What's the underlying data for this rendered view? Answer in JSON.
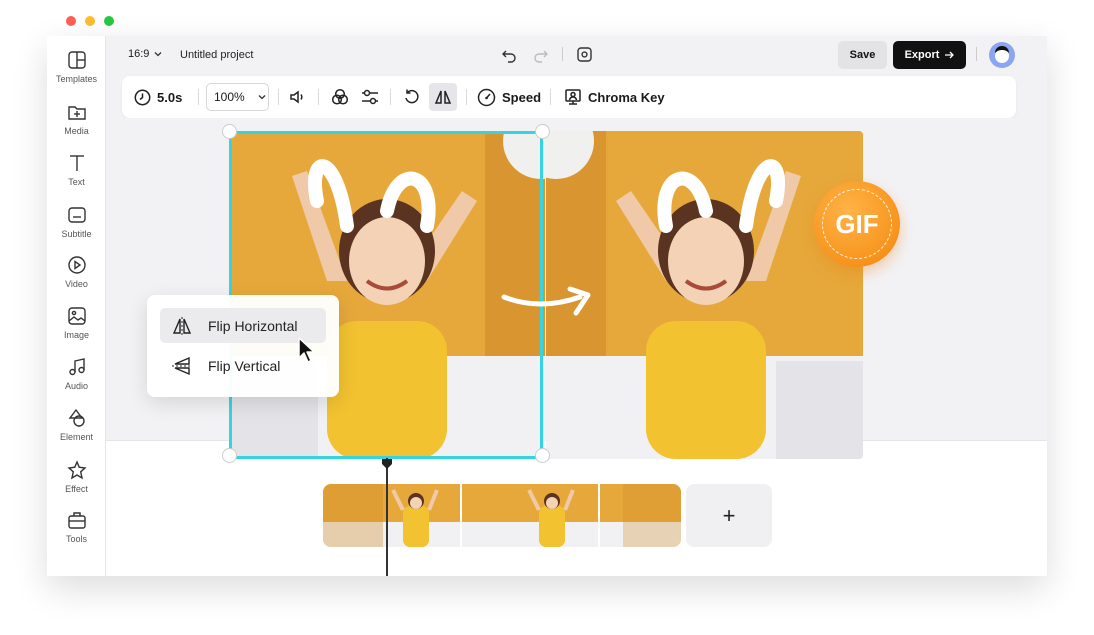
{
  "window": {
    "traffic_colors": [
      "#fe5f57",
      "#febc2e",
      "#28c840"
    ]
  },
  "sidebar": {
    "items": [
      {
        "label": "Templates",
        "icon": "templates-icon"
      },
      {
        "label": "Media",
        "icon": "media-icon"
      },
      {
        "label": "Text",
        "icon": "text-icon"
      },
      {
        "label": "Subtitle",
        "icon": "subtitle-icon"
      },
      {
        "label": "Video",
        "icon": "video-icon"
      },
      {
        "label": "Image",
        "icon": "image-icon"
      },
      {
        "label": "Audio",
        "icon": "audio-icon"
      },
      {
        "label": "Element",
        "icon": "element-icon"
      },
      {
        "label": "Effect",
        "icon": "effect-icon"
      },
      {
        "label": "Tools",
        "icon": "tools-icon"
      }
    ]
  },
  "header": {
    "aspect_ratio": "16:9",
    "project_name": "Untitled project",
    "save_label": "Save",
    "export_label": "Export"
  },
  "toolbar": {
    "duration": "5.0s",
    "zoom": "100%",
    "speed_label": "Speed",
    "chroma_label": "Chroma Key"
  },
  "flip_menu": {
    "horizontal_label": "Flip Horizontal",
    "vertical_label": "Flip Vertical"
  },
  "badge": {
    "label": "GIF"
  },
  "timeline": {
    "add_label": "+"
  },
  "colors": {
    "accent": "#35d4e2",
    "export_bg": "#111111",
    "gif_orange": "#f7941d",
    "wall": "#e6a83a",
    "dress": "#f2c230"
  }
}
